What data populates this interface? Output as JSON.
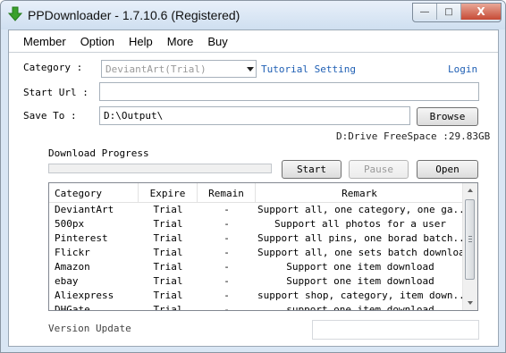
{
  "window": {
    "title": "PPDownloader - 1.7.10.6 (Registered)",
    "min_glyph": "―",
    "max_glyph": "□",
    "close_glyph": "X"
  },
  "menu": [
    "Member",
    "Option",
    "Help",
    "More",
    "Buy"
  ],
  "form": {
    "category_label": "Category :",
    "category_value": "DeviantArt(Trial)",
    "tutorial_link": "Tutorial Setting",
    "login_link": "Login",
    "start_url_label": "Start Url :",
    "start_url_value": "",
    "save_to_label": "Save To :",
    "save_to_value": "D:\\Output\\",
    "browse_label": "Browse",
    "freespace": "D:Drive FreeSpace :29.83GB"
  },
  "download": {
    "progress_label": "Download Progress",
    "progress_value": 0,
    "start_label": "Start",
    "pause_label": "Pause",
    "open_label": "Open"
  },
  "table": {
    "headers": [
      "Category",
      "Expire",
      "Remain",
      "Remark"
    ],
    "rows": [
      {
        "category": "DeviantArt",
        "expire": "Trial",
        "remain": "-",
        "remark": "Support all, one category, one ga..."
      },
      {
        "category": "500px",
        "expire": "Trial",
        "remain": "-",
        "remark": "Support all photos for a user"
      },
      {
        "category": "Pinterest",
        "expire": "Trial",
        "remain": "-",
        "remark": "Support all pins, one borad batch..."
      },
      {
        "category": "Flickr",
        "expire": "Trial",
        "remain": "-",
        "remark": "Support all, one sets batch download"
      },
      {
        "category": "Amazon",
        "expire": "Trial",
        "remain": "-",
        "remark": "Support one item download"
      },
      {
        "category": "ebay",
        "expire": "Trial",
        "remain": "-",
        "remark": "Support one item download"
      },
      {
        "category": "Aliexpress",
        "expire": "Trial",
        "remain": "-",
        "remark": "support shop, category, item down..."
      },
      {
        "category": "DHGate",
        "expire": "Trial",
        "remain": "-",
        "remark": "support one item download"
      }
    ]
  },
  "footer": {
    "version_label": "Version Update",
    "update_value": ""
  },
  "colors": {
    "link": "#1f5fb4",
    "frame": "#d9e6f4",
    "app_icon": "#3ba02c"
  }
}
